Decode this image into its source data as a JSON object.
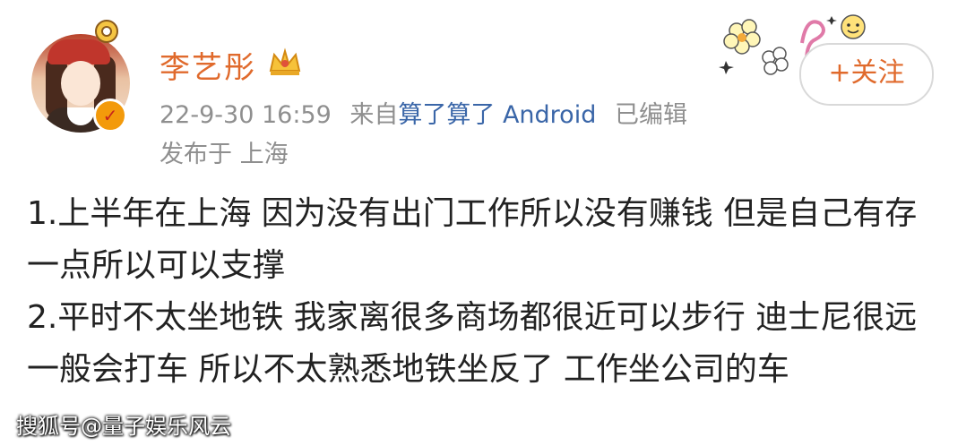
{
  "post": {
    "username": "李艺彤",
    "timestamp": "22-9-30 16:59",
    "from_label": "来自",
    "source": "算了算了 Android",
    "edited_label": "已编辑",
    "location": "发布于 上海",
    "follow_label": "+关注",
    "body": [
      "1.上半年在上海 因为没有出门工作所以没有赚钱 但是自己有存一点所以可以支撑",
      "2.平时不太坐地铁 我家离很多商场都很近可以步行 迪士尼很远一般会打车 所以不太熟悉地铁坐反了 工作坐公司的车"
    ]
  },
  "watermark": "搜狐号@量子娱乐风云",
  "colors": {
    "username": "#e06a2c",
    "meta": "#8f8f8f",
    "source_link": "#3a66a8",
    "body_text": "#222222"
  },
  "icons": [
    "verified-badge-icon",
    "crown-icon",
    "flower-decoration-icon"
  ]
}
